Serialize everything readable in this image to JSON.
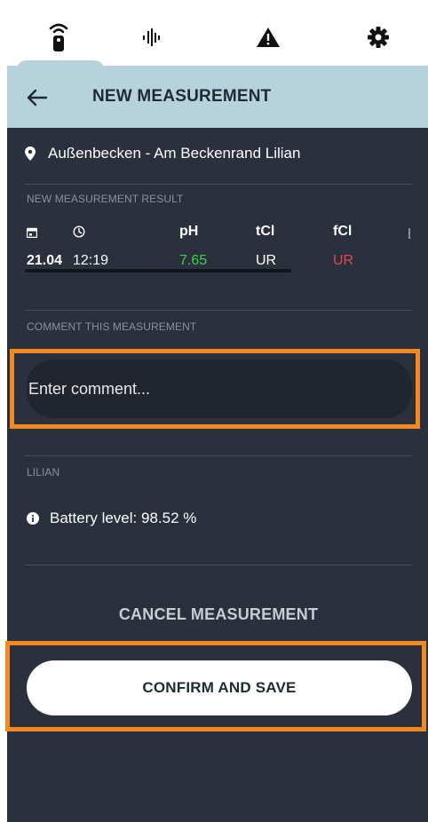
{
  "tabs": [
    {
      "icon": "remote-sensor-icon",
      "active": true
    },
    {
      "icon": "waveform-icon",
      "active": false
    },
    {
      "icon": "warning-icon",
      "active": false
    },
    {
      "icon": "gear-icon",
      "active": false
    }
  ],
  "header": {
    "title": "NEW MEASUREMENT",
    "back_icon": "arrow-left-icon"
  },
  "location": {
    "icon": "location-pin-icon",
    "text": "Außenbecken - Am Beckenrand Lilian"
  },
  "result_section": {
    "label": "NEW MEASUREMENT RESULT",
    "icons": [
      "calendar-icon",
      "clock-icon"
    ],
    "columns": [
      "pH",
      "tCl",
      "fCl"
    ],
    "date": "21.04",
    "time": "12:19",
    "values": [
      {
        "text": "7.65",
        "color": "#3fd14a"
      },
      {
        "text": "UR",
        "color": "#ffffff"
      },
      {
        "text": "UR",
        "color": "#e64556"
      }
    ]
  },
  "comment_section": {
    "label": "COMMENT THIS MEASUREMENT",
    "placeholder": "Enter comment..."
  },
  "device_section": {
    "label": "LILIAN",
    "battery_icon": "info-icon",
    "battery_text": "Battery level: 98.52 %"
  },
  "actions": {
    "cancel_label": "CANCEL MEASUREMENT",
    "confirm_label": "CONFIRM AND SAVE"
  },
  "colors": {
    "background": "#2a303c",
    "header": "#b6d2dd",
    "highlight": "#f28a1f",
    "ph_value": "#3fd14a",
    "fcl_value": "#e64556"
  }
}
